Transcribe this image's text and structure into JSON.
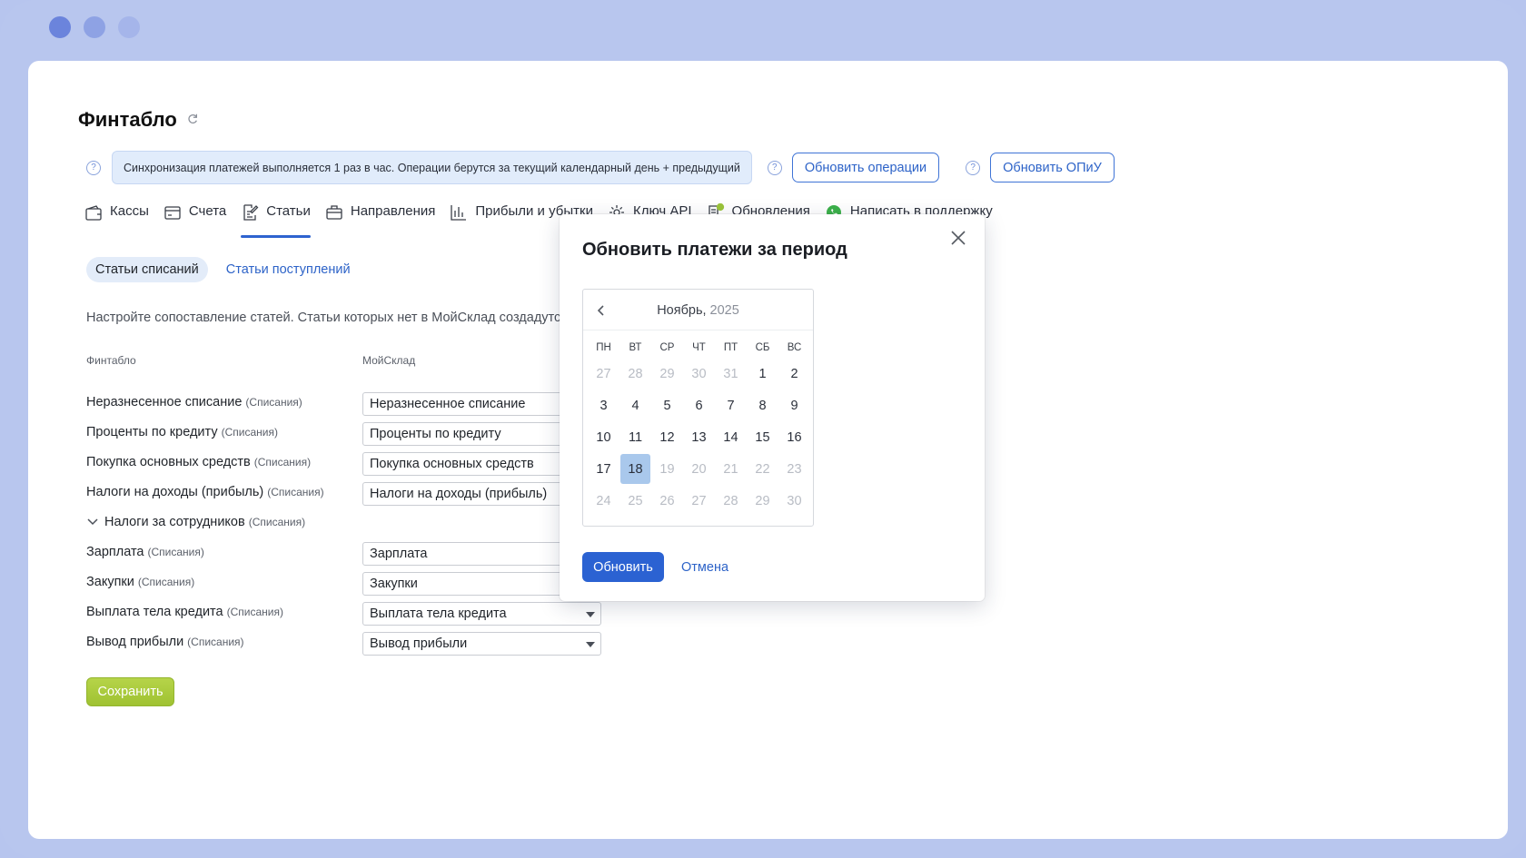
{
  "app": {
    "title": "Финтабло",
    "sync_info": "Синхронизация платежей выполняется 1 раз в час. Операции берутся за текущий календарный день + предыдущий",
    "update_operations_label": "Обновить операции",
    "update_pnl_label": "Обновить ОПиУ"
  },
  "tabs": [
    {
      "label": "Кассы",
      "icon": "wallet-icon"
    },
    {
      "label": "Счета",
      "icon": "card-icon"
    },
    {
      "label": "Статьи",
      "icon": "edit-list-icon",
      "active": true
    },
    {
      "label": "Направления",
      "icon": "briefcase-icon"
    },
    {
      "label": "Прибыли и убытки",
      "icon": "bar-chart-icon"
    },
    {
      "label": "Ключ API",
      "icon": "gear-icon"
    },
    {
      "label": "Обновления",
      "icon": "updates-icon"
    },
    {
      "label": "Написать в поддержку",
      "icon": "whatsapp-icon"
    }
  ],
  "subtabs": {
    "expenses": "Статьи списаний",
    "income": "Статьи поступлений"
  },
  "hint": "Настройте сопоставление статей. Статьи которых нет в МойСклад создадутся",
  "columns": {
    "fintablo": "Финтабло",
    "moysklad": "МойСклад"
  },
  "rows": [
    {
      "label": "Неразнесенное списание",
      "tag": "(Списания)",
      "value": "Неразнесенное списание"
    },
    {
      "label": "Проценты по кредиту",
      "tag": "(Списания)",
      "value": "Проценты по кредиту"
    },
    {
      "label": "Покупка основных средств",
      "tag": "(Списания)",
      "value": "Покупка основных средств"
    },
    {
      "label": "Налоги на доходы (прибыль)",
      "tag": "(Списания)",
      "value": "Налоги на доходы (прибыль)"
    },
    {
      "label": "Налоги за сотрудников",
      "tag": "(Списания)",
      "group": true
    },
    {
      "label": "Зарплата",
      "tag": "(Списания)",
      "value": "Зарплата"
    },
    {
      "label": "Закупки",
      "tag": "(Списания)",
      "value": "Закупки"
    },
    {
      "label": "Выплата тела кредита",
      "tag": "(Списания)",
      "value": "Выплата тела кредита"
    },
    {
      "label": "Вывод прибыли",
      "tag": "(Списания)",
      "value": "Вывод прибыли"
    }
  ],
  "save_label": "Сохранить",
  "modal": {
    "title": "Обновить платежи за период",
    "month": "Ноябрь,",
    "year": "2025",
    "weekdays": [
      "ПН",
      "ВТ",
      "СР",
      "ЧТ",
      "ПТ",
      "СБ",
      "ВС"
    ],
    "days": [
      {
        "d": "27",
        "muted": true
      },
      {
        "d": "28",
        "muted": true
      },
      {
        "d": "29",
        "muted": true
      },
      {
        "d": "30",
        "muted": true
      },
      {
        "d": "31",
        "muted": true
      },
      {
        "d": "1"
      },
      {
        "d": "2"
      },
      {
        "d": "3"
      },
      {
        "d": "4"
      },
      {
        "d": "5"
      },
      {
        "d": "6"
      },
      {
        "d": "7"
      },
      {
        "d": "8"
      },
      {
        "d": "9"
      },
      {
        "d": "10"
      },
      {
        "d": "11"
      },
      {
        "d": "12"
      },
      {
        "d": "13"
      },
      {
        "d": "14"
      },
      {
        "d": "15"
      },
      {
        "d": "16"
      },
      {
        "d": "17"
      },
      {
        "d": "18",
        "selected": true
      },
      {
        "d": "19",
        "muted": true
      },
      {
        "d": "20",
        "muted": true
      },
      {
        "d": "21",
        "muted": true
      },
      {
        "d": "22",
        "muted": true
      },
      {
        "d": "23",
        "muted": true
      },
      {
        "d": "24",
        "muted": true
      },
      {
        "d": "25",
        "muted": true
      },
      {
        "d": "26",
        "muted": true
      },
      {
        "d": "27",
        "muted": true
      },
      {
        "d": "28",
        "muted": true
      },
      {
        "d": "29",
        "muted": true
      },
      {
        "d": "30",
        "muted": true
      }
    ],
    "confirm_label": "Обновить",
    "cancel_label": "Отмена"
  },
  "colors": {
    "accent": "#2b62d2",
    "save": "#a8c93b",
    "banner": "#e1ecfb",
    "frame": "#b8c6ee"
  }
}
